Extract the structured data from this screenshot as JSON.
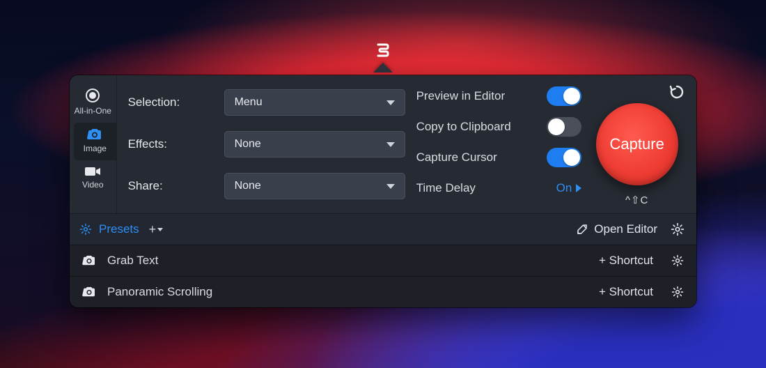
{
  "sidebar": {
    "tabs": [
      {
        "label": "All-in-One"
      },
      {
        "label": "Image"
      },
      {
        "label": "Video"
      }
    ],
    "selected_index": 1
  },
  "settings": {
    "selection": {
      "label": "Selection:",
      "value": "Menu"
    },
    "effects": {
      "label": "Effects:",
      "value": "None"
    },
    "share": {
      "label": "Share:",
      "value": "None"
    }
  },
  "toggles": {
    "preview_in_editor": {
      "label": "Preview in Editor",
      "on": true
    },
    "copy_to_clipboard": {
      "label": "Copy to Clipboard",
      "on": false
    },
    "capture_cursor": {
      "label": "Capture Cursor",
      "on": true
    },
    "time_delay": {
      "label": "Time Delay",
      "value": "On"
    }
  },
  "capture": {
    "button_label": "Capture",
    "shortcut": "^⇧C"
  },
  "presets_bar": {
    "label": "Presets",
    "open_editor": "Open Editor"
  },
  "presets": [
    {
      "label": "Grab Text",
      "shortcut_label": "+ Shortcut"
    },
    {
      "label": "Panoramic Scrolling",
      "shortcut_label": "+ Shortcut"
    }
  ]
}
